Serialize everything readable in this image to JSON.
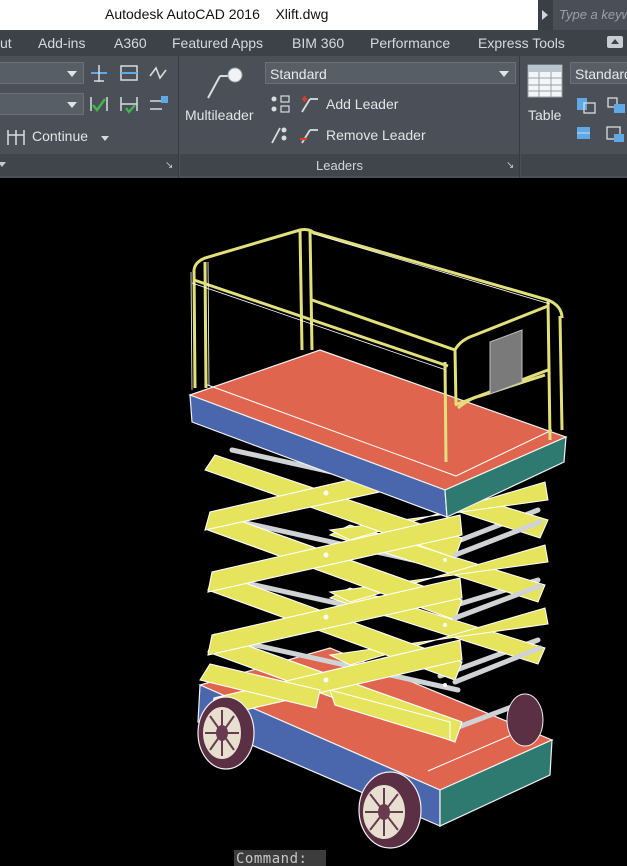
{
  "window": {
    "title": "Autodesk AutoCAD 2016    Xlift.dwg",
    "search_placeholder": "Type a keyw"
  },
  "ribbon_tabs": [
    "ut",
    "Add-ins",
    "A360",
    "Featured Apps",
    "BIM 360",
    "Performance",
    "Express Tools"
  ],
  "dimension_panel": {
    "continue_label": "Continue",
    "icons": [
      "linear-dim-icon",
      "baseline-dim-icon",
      "jogged-line-icon",
      "break-dim-icon",
      "inspect-dim-icon",
      "adjust-space-icon"
    ]
  },
  "leaders_panel": {
    "multileader_label": "Multileader",
    "style_value": "Standard",
    "add_leader_label": "Add Leader",
    "remove_leader_label": "Remove Leader",
    "footer_label": "Leaders"
  },
  "tables_panel": {
    "table_label": "Table",
    "style_value": "Standard"
  },
  "drawing": {
    "subject": "scissor-lift-3d-model",
    "colors": {
      "platform_top": "#e0654e",
      "platform_side": "#4a67ad",
      "platform_end": "#2f7a70",
      "rails": "#e2e07a",
      "scissor_arms": "#e6e35c",
      "background": "#000000"
    }
  },
  "command_line": {
    "prompt": "Command:"
  }
}
